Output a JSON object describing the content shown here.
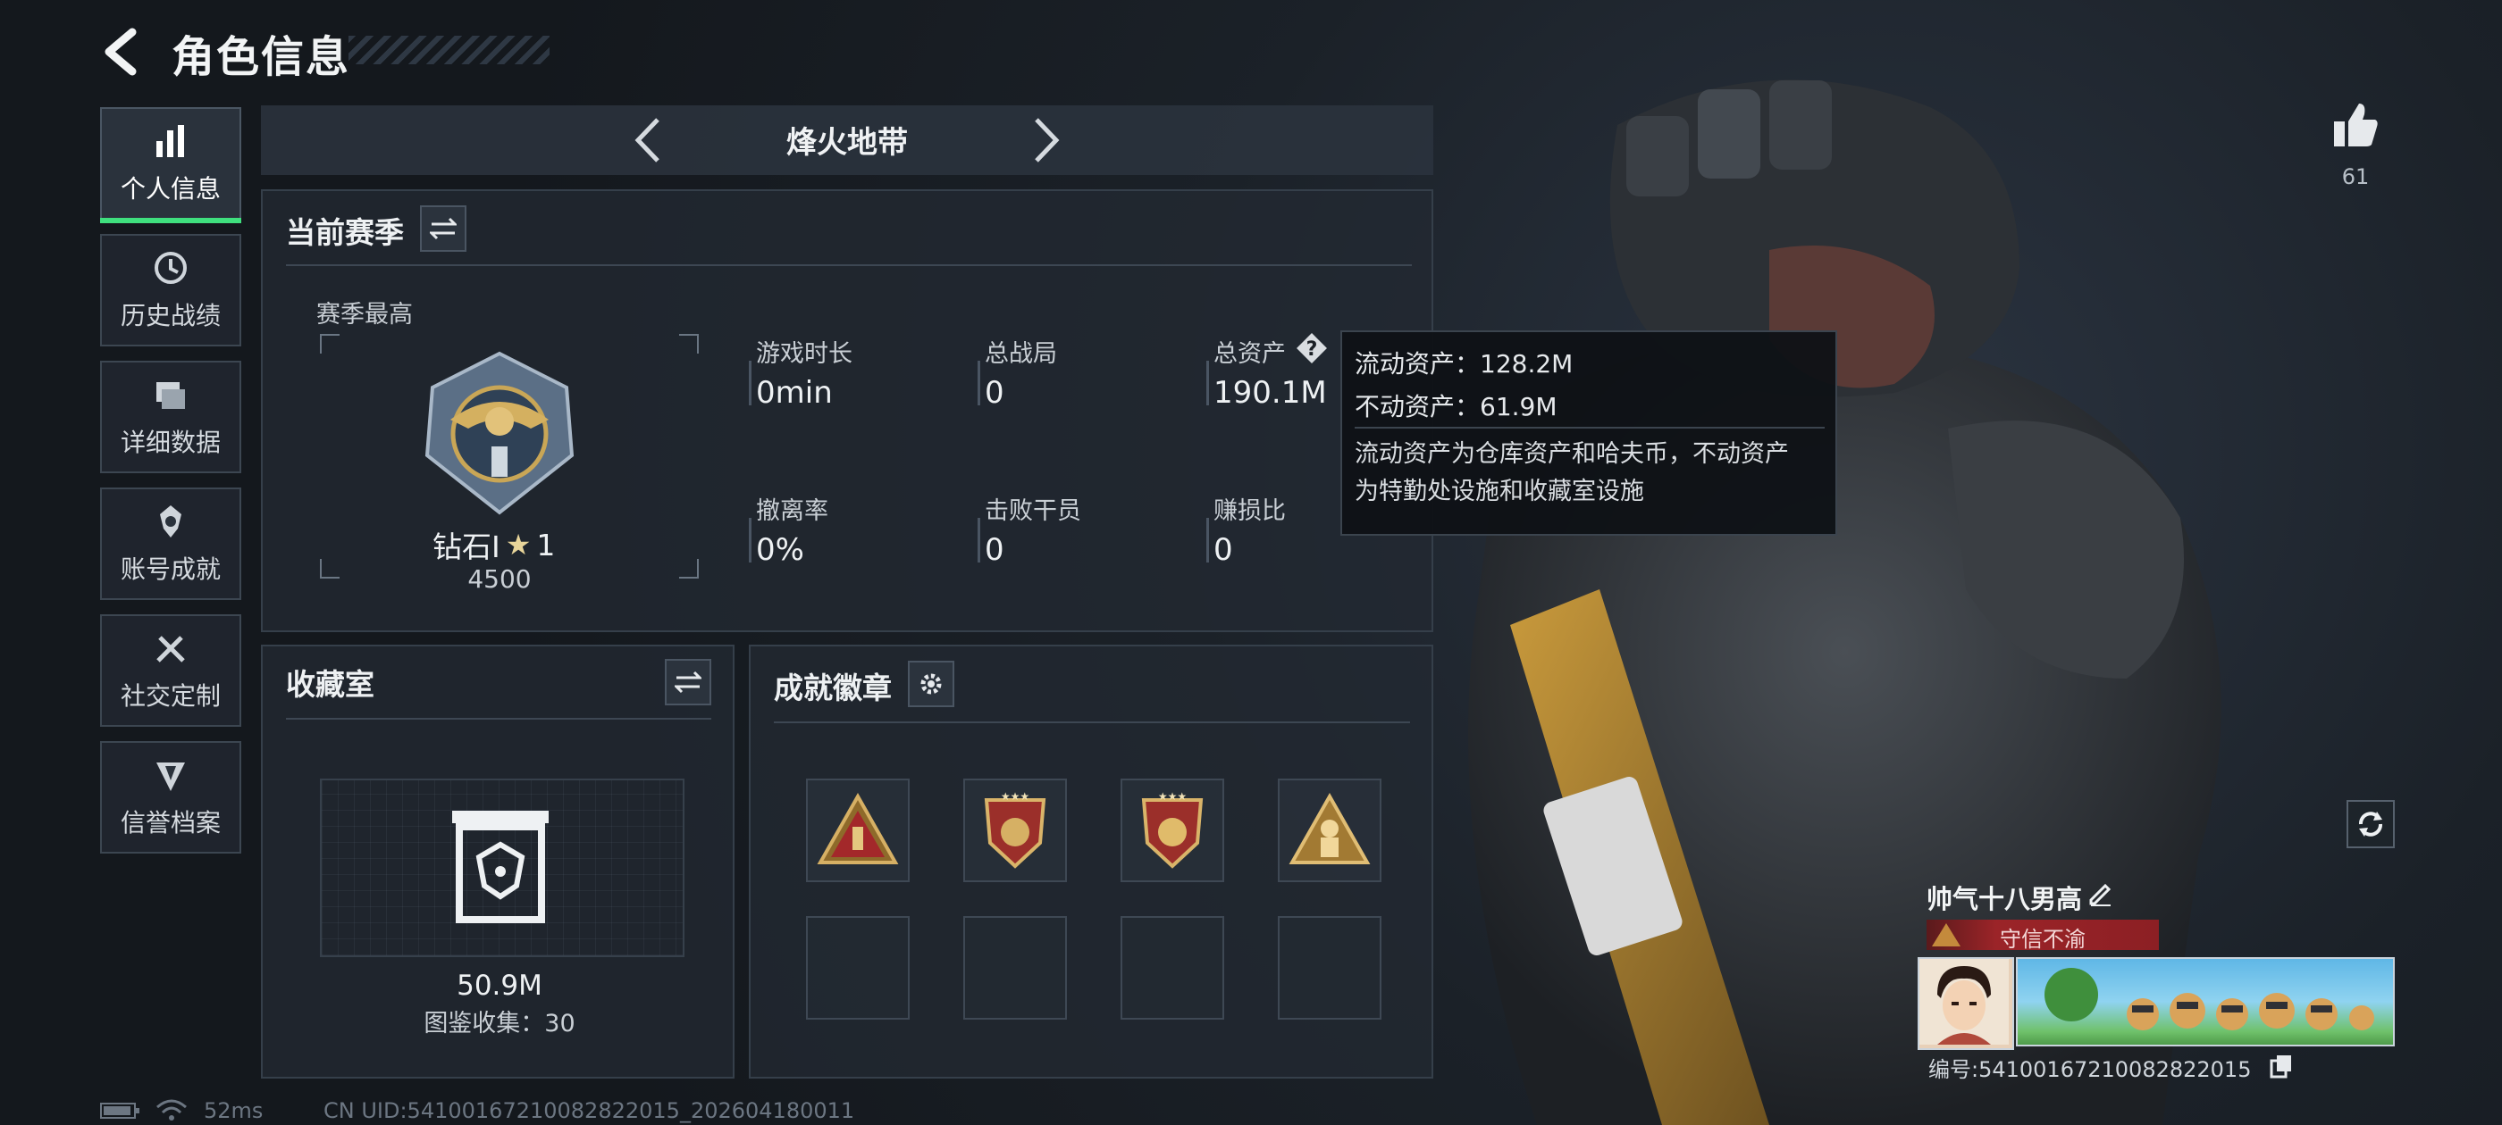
{
  "header": {
    "title": "角色信息"
  },
  "sidebar": {
    "items": [
      {
        "label": "个人信息",
        "icon": "bar-chart-icon",
        "active": true
      },
      {
        "label": "历史战绩",
        "icon": "clock-history-icon",
        "active": false
      },
      {
        "label": "详细数据",
        "icon": "folders-icon",
        "active": false
      },
      {
        "label": "账号成就",
        "icon": "achievement-icon",
        "active": false
      },
      {
        "label": "社交定制",
        "icon": "tools-icon",
        "active": false
      },
      {
        "label": "信誉档案",
        "icon": "shield-credit-icon",
        "active": false
      }
    ]
  },
  "mode_nav": {
    "title": "烽火地带"
  },
  "season": {
    "title": "当前赛季",
    "best_label": "赛季最高",
    "rank_name": "钻石Ⅰ",
    "rank_stars": "1",
    "rank_points": "4500",
    "stats": [
      {
        "label": "游戏时长",
        "value": "0min"
      },
      {
        "label": "总战局",
        "value": "0"
      },
      {
        "label": "总资产",
        "value": "190.1M"
      },
      {
        "label": "撤离率",
        "value": "0%"
      },
      {
        "label": "击败干员",
        "value": "0"
      },
      {
        "label": "赚损比",
        "value": "0"
      }
    ]
  },
  "tooltip": {
    "line1": "流动资产：128.2M",
    "line2": "不动资产：61.9M",
    "desc1": "流动资产为仓库资产和哈夫币，不动资产",
    "desc2": "为特勤处设施和收藏室设施"
  },
  "collection": {
    "title": "收藏室",
    "value": "50.9M",
    "catalog": "图鉴收集：30"
  },
  "badges": {
    "title": "成就徽章",
    "items": [
      "triangle-flag-badge",
      "shield-star-badge",
      "shield-star-badge-2",
      "triangle-soldier-badge"
    ]
  },
  "likes": {
    "count": "61"
  },
  "player": {
    "name": "帅气十八男高",
    "credit_tag": "守信不渝",
    "id_line": "编号:54100167210082822015"
  },
  "status_bar": {
    "ping": "52ms",
    "uid": "CN UID:54100167210082822015_202604180011"
  },
  "colors": {
    "accent": "#3fe07e",
    "credit_red": "#8c1f24",
    "panel": "#222932"
  }
}
